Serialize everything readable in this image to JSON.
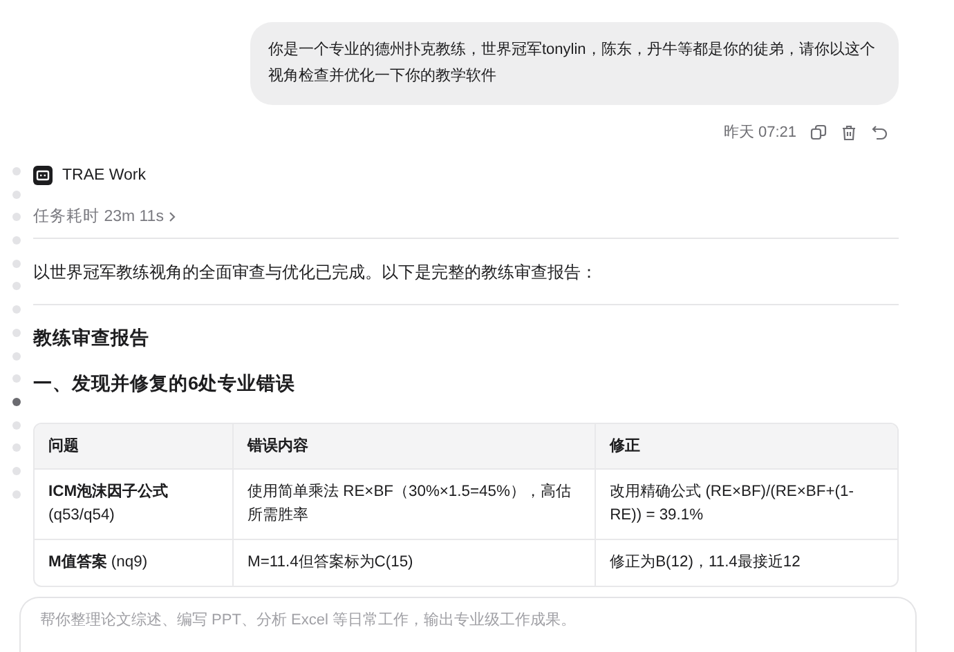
{
  "timeline": [
    {
      "selected": false
    },
    {
      "selected": false
    },
    {
      "selected": false
    },
    {
      "selected": false
    },
    {
      "selected": false
    },
    {
      "selected": false
    },
    {
      "selected": false
    },
    {
      "selected": false
    },
    {
      "selected": false
    },
    {
      "selected": false
    },
    {
      "selected": true
    },
    {
      "selected": false
    },
    {
      "selected": false
    },
    {
      "selected": false
    },
    {
      "selected": false
    }
  ],
  "user_message": {
    "text": "你是一个专业的德州扑克教练，世界冠军tonylin，陈东，丹牛等都是你的徒弟，请你以这个视角检查并优化一下你的教学软件",
    "time": "昨天 07:21"
  },
  "assistant": {
    "name": "TRAE Work",
    "duration": "任务耗时 23m 11s",
    "intro": "以世界冠军教练视角的全面审查与优化已完成。以下是完整的教练审查报告：",
    "heading": "教练审查报告",
    "subheading": "一、发现并修复的6处专业错误",
    "table": {
      "columns": [
        "问题",
        "错误内容",
        "修正"
      ],
      "rows": [
        [
          "**ICM泡沫因子公式** (q53/q54)",
          "使用简单乘法 RE×BF（30%×1.5=45%），高估所需胜率",
          "改用精确公式 (RE×BF)/(RE×BF+(1-RE)) = 39.1%"
        ],
        [
          "**M值答案** (nq9)",
          "M=11.4但答案标为C(15)",
          "修正为B(12)，11.4最接近12"
        ]
      ]
    }
  },
  "input": {
    "placeholder": "帮你整理论文综述、编写 PPT、分析 Excel 等日常工作，输出专业级工作成果。"
  }
}
